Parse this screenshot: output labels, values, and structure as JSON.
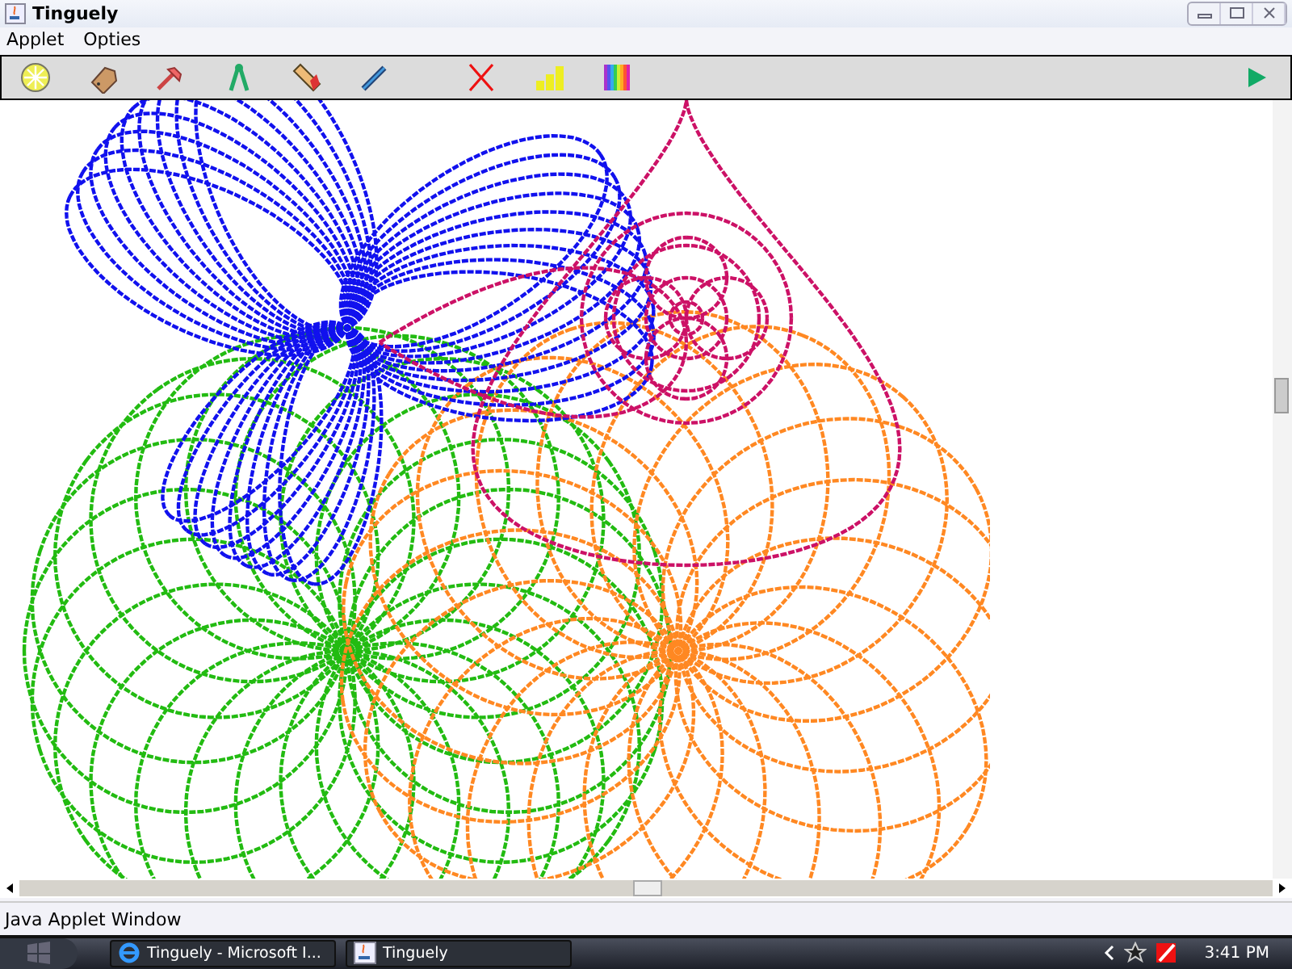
{
  "window": {
    "title": "Tinguely"
  },
  "menu": [
    "Applet",
    "Opties"
  ],
  "status_bar": "Java Applet Window",
  "taskbar": {
    "tasks": [
      {
        "label": "Tinguely - Microsoft I..."
      },
      {
        "label": "Tinguely"
      }
    ],
    "clock": "3:41 PM"
  }
}
